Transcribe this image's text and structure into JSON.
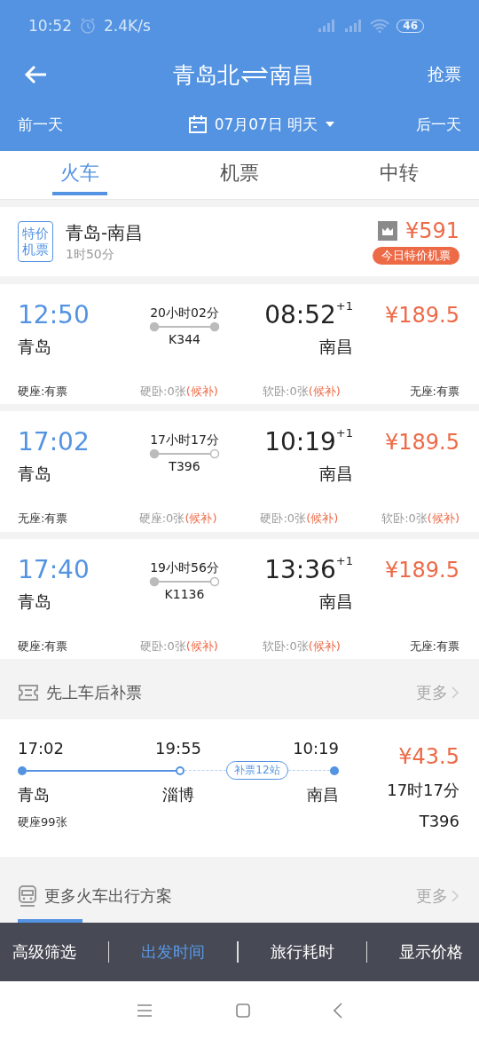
{
  "status_bar": {
    "time": "10:52",
    "speed": "2.4K/s",
    "battery": "46"
  },
  "header": {
    "from": "青岛北",
    "to": "南昌",
    "action": "抢票"
  },
  "date_bar": {
    "prev": "前一天",
    "date": "07月07日 明天",
    "next": "后一天"
  },
  "tabs": [
    {
      "label": "火车",
      "selected": true
    },
    {
      "label": "机票",
      "selected": false
    },
    {
      "label": "中转",
      "selected": false
    }
  ],
  "flight_deal": {
    "badge_lines": [
      "特价",
      "机票"
    ],
    "route": "青岛-南昌",
    "duration": "1时50分",
    "price": "¥591",
    "tag": "今日特价机票"
  },
  "trains": [
    {
      "depart_time": "12:50",
      "depart_station": "青岛",
      "duration": "20小时02分",
      "train_no": "K344",
      "start_station": true,
      "end_station": true,
      "arrive_time": "08:52",
      "day_offset": "+1",
      "arrive_station": "南昌",
      "price": "¥189.5",
      "seats": [
        {
          "kind": "available",
          "text": "硬座:有票"
        },
        {
          "kind": "waitlist",
          "text": "硬卧:0张",
          "waitlist": "(候补)"
        },
        {
          "kind": "waitlist",
          "text": "软卧:0张",
          "waitlist": "(候补)"
        },
        {
          "kind": "available",
          "text": "无座:有票"
        }
      ]
    },
    {
      "depart_time": "17:02",
      "depart_station": "青岛",
      "duration": "17小时17分",
      "train_no": "T396",
      "start_station": true,
      "end_station": false,
      "arrive_time": "10:19",
      "day_offset": "+1",
      "arrive_station": "南昌",
      "price": "¥189.5",
      "seats": [
        {
          "kind": "available",
          "text": "无座:有票"
        },
        {
          "kind": "waitlist",
          "text": "硬座:0张",
          "waitlist": "(候补)"
        },
        {
          "kind": "waitlist",
          "text": "硬卧:0张",
          "waitlist": "(候补)"
        },
        {
          "kind": "waitlist",
          "text": "软卧:0张",
          "waitlist": "(候补)"
        }
      ]
    },
    {
      "depart_time": "17:40",
      "depart_station": "青岛",
      "duration": "19小时56分",
      "train_no": "K1136",
      "start_station": true,
      "end_station": false,
      "arrive_time": "13:36",
      "day_offset": "+1",
      "arrive_station": "南昌",
      "price": "¥189.5",
      "seats": [
        {
          "kind": "available",
          "text": "硬座:有票"
        },
        {
          "kind": "waitlist",
          "text": "硬卧:0张",
          "waitlist": "(候补)"
        },
        {
          "kind": "waitlist",
          "text": "软卧:0张",
          "waitlist": "(候补)"
        },
        {
          "kind": "available",
          "text": "无座:有票"
        }
      ]
    }
  ],
  "board_first_section": {
    "title": "先上车后补票",
    "more": "更多"
  },
  "transfer": {
    "depart_time": "17:02",
    "board_time": "19:55",
    "arrive_time": "10:19",
    "depart_station": "青岛",
    "board_station": "淄博",
    "arrive_station": "南昌",
    "badge": "补票12站",
    "seats": "硬座99张",
    "price": "¥43.5",
    "duration": "17时17分",
    "train_no": "T396"
  },
  "more_section": {
    "title": "更多火车出行方案",
    "more": "更多"
  },
  "bottom_bar": [
    {
      "label": "高级筛选",
      "selected": false
    },
    {
      "label": "出发时间",
      "selected": true
    },
    {
      "label": "旅行耗时",
      "selected": false
    },
    {
      "label": "显示价格",
      "selected": false
    }
  ]
}
